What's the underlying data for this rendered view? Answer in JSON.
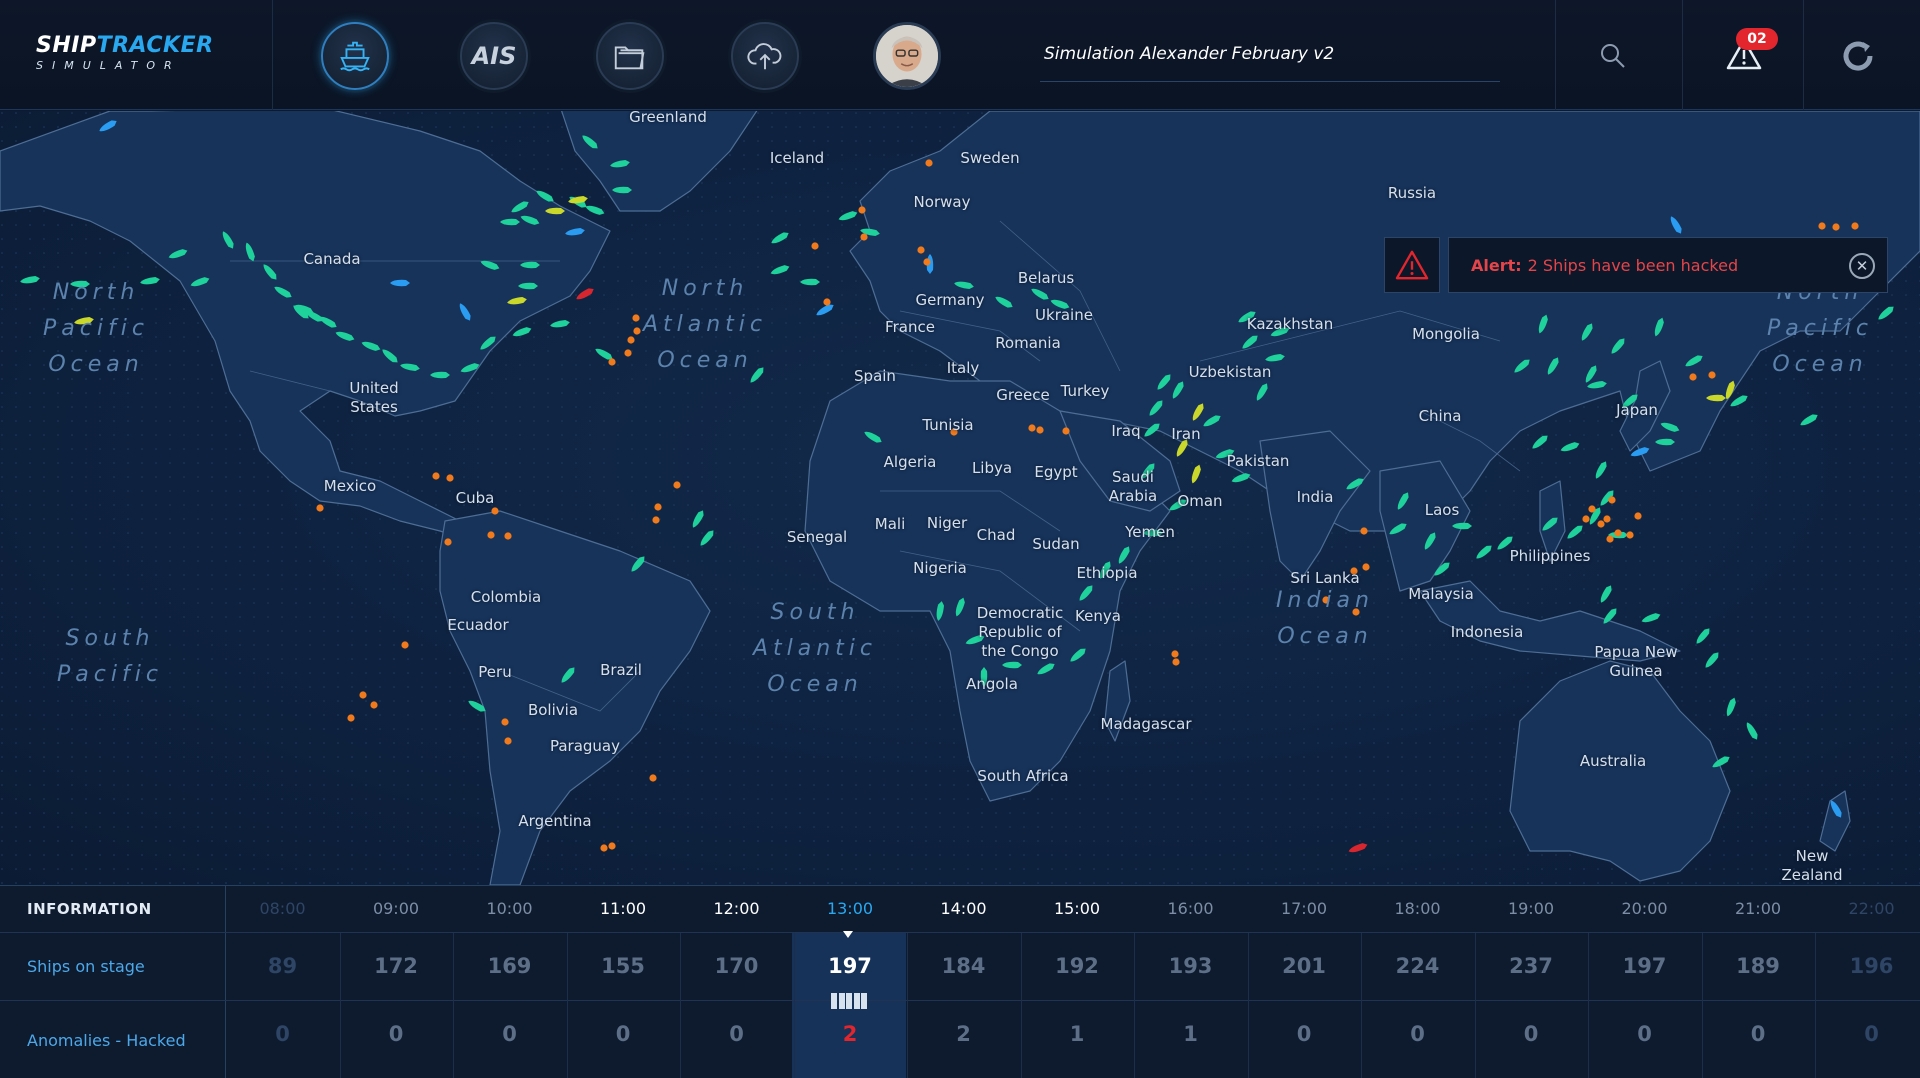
{
  "app": {
    "logo_line1_a": "SHIP",
    "logo_line1_b": "TRACKER",
    "logo_line2": "SIMULATOR",
    "simulation_title": "Simulation Alexander February v2",
    "alerts_count": "02"
  },
  "nav": [
    {
      "name": "ship-nav-button",
      "icon": "ship-icon",
      "active": true
    },
    {
      "name": "ais-nav-button",
      "label": "AIS"
    },
    {
      "name": "folder-nav-button",
      "icon": "folder-icon"
    },
    {
      "name": "cloud-upload-nav-button",
      "icon": "cloud-upload-icon"
    }
  ],
  "alert": {
    "prefix": "Alert:",
    "message": "2 Ships have been hacked"
  },
  "oceans": [
    {
      "text": "North\nPacific\nOcean"
    },
    {
      "text": "North\nAtlantic\nOcean"
    },
    {
      "text": "North\nPacific\nOcean"
    },
    {
      "text": "South\nAtlantic\nOcean"
    },
    {
      "text": "Indian\nOcean"
    },
    {
      "text": "South\nPacific\nOcean"
    }
  ],
  "places": [
    "Greenland",
    "Iceland",
    "Sweden",
    "Norway",
    "Russia",
    "Canada",
    "Belarus",
    "Germany",
    "Ukraine",
    "France",
    "Romania",
    "Kazakhstan",
    "Mongolia",
    "United\nStates",
    "Spain",
    "Italy",
    "Uzbekistan",
    "Greece",
    "Turkey",
    "Japan",
    "China",
    "Tunisia",
    "Iraq",
    "Iran",
    "Mexico",
    "Algeria",
    "Libya",
    "Egypt",
    "Pakistan",
    "Saudi\nArabia",
    "Oman",
    "India",
    "Cuba",
    "Senegal",
    "Mali",
    "Niger",
    "Chad",
    "Sudan",
    "Yemen",
    "Laos",
    "Philippines",
    "Nigeria",
    "Ethiopia",
    "Sri Lanka",
    "Colombia",
    "Malaysia",
    "Democratic\nRepublic of\nthe Congo",
    "Kenya",
    "Ecuador",
    "Indonesia",
    "Papua New\nGuinea",
    "Peru",
    "Brazil",
    "Angola",
    "Bolivia",
    "Paraguay",
    "Madagascar",
    "South Africa",
    "Australia",
    "Argentina",
    "New\nZealand"
  ],
  "info_table": {
    "title": "INFORMATION",
    "row_ships_label": "Ships on stage",
    "row_anomalies_label": "Anomalies - Hacked",
    "selected_time": "13:00",
    "columns": [
      {
        "time": "08:00",
        "ships": "89",
        "hacked": "0"
      },
      {
        "time": "09:00",
        "ships": "172",
        "hacked": "0"
      },
      {
        "time": "10:00",
        "ships": "169",
        "hacked": "0"
      },
      {
        "time": "11:00",
        "ships": "155",
        "hacked": "0"
      },
      {
        "time": "12:00",
        "ships": "170",
        "hacked": "0"
      },
      {
        "time": "13:00",
        "ships": "197",
        "hacked": "2"
      },
      {
        "time": "14:00",
        "ships": "184",
        "hacked": "2"
      },
      {
        "time": "15:00",
        "ships": "192",
        "hacked": "1"
      },
      {
        "time": "16:00",
        "ships": "193",
        "hacked": "1"
      },
      {
        "time": "17:00",
        "ships": "201",
        "hacked": "0"
      },
      {
        "time": "18:00",
        "ships": "224",
        "hacked": "0"
      },
      {
        "time": "19:00",
        "ships": "237",
        "hacked": "0"
      },
      {
        "time": "20:00",
        "ships": "197",
        "hacked": "0"
      },
      {
        "time": "21:00",
        "ships": "189",
        "hacked": "0"
      },
      {
        "time": "22:00",
        "ships": "196",
        "hacked": "0"
      }
    ]
  },
  "colors": {
    "accent": "#29a8f0",
    "alert_red": "#e3262d",
    "ship_green": "#1fd19a",
    "ship_blue": "#2a9df2",
    "ship_yellow": "#c9d82a",
    "ship_red": "#d8262f",
    "port_orange": "#f07a1c"
  }
}
